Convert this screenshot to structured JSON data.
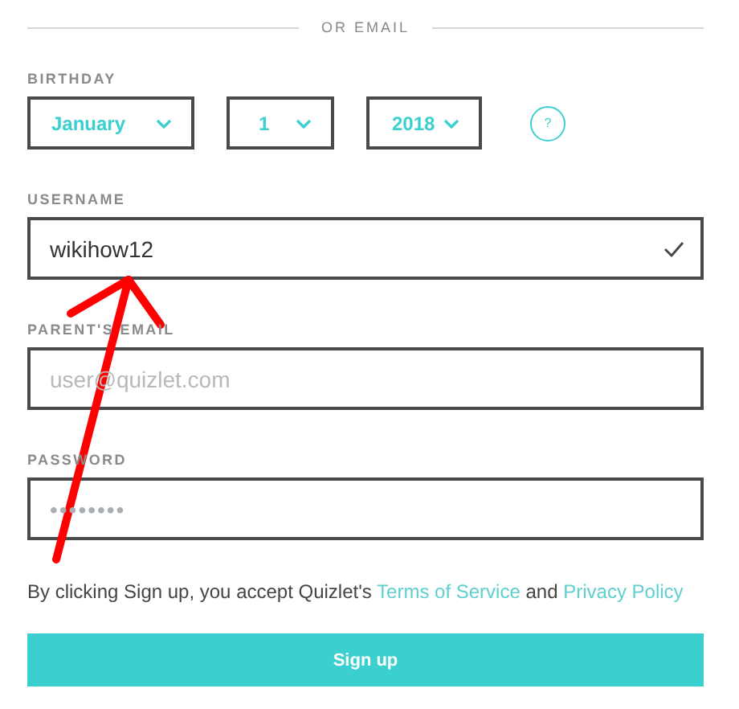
{
  "divider_label": "OR EMAIL",
  "birthday": {
    "label": "BIRTHDAY",
    "selects": [
      {
        "value": "January"
      },
      {
        "value": "1"
      },
      {
        "value": "2018"
      }
    ],
    "help": "?"
  },
  "fields": [
    {
      "label": "USERNAME",
      "value": "wikihow12",
      "valid": true
    },
    {
      "label": "PARENT'S EMAIL",
      "placeholder": "user@quizlet.com",
      "valid": false
    },
    {
      "label": "PASSWORD",
      "value": "••••••••",
      "valid": false
    }
  ],
  "terms": {
    "text": "By clicking Sign up, you accept Quizlet's",
    "link_1": "Terms of Service",
    "joiner": "and",
    "link_2": "Privacy Policy"
  },
  "submit": "Sign up"
}
